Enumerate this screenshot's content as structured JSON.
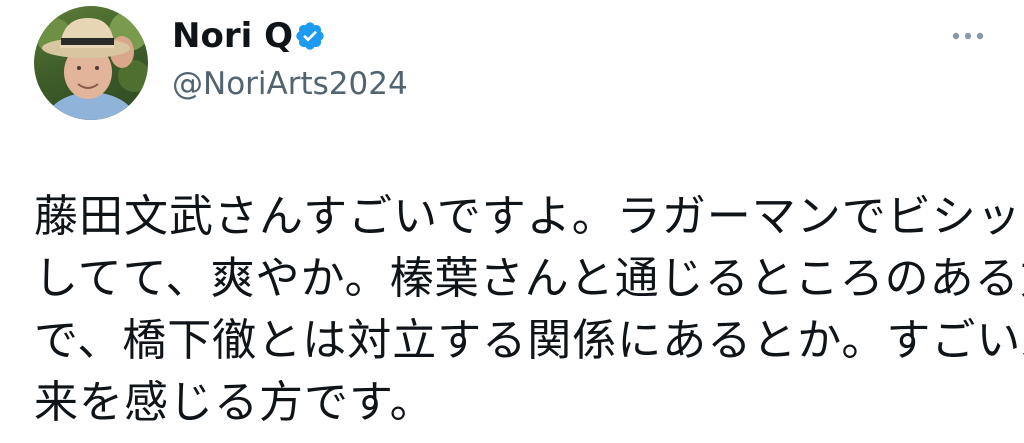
{
  "author": {
    "display_name": "Nori Q",
    "handle": "@NoriArts2024",
    "verified": true,
    "accent_color": "#1d9bf0"
  },
  "icons": {
    "verified": "verified-badge-icon",
    "more": "more-options-icon"
  },
  "tweet": {
    "lines": [
      "藤田文武さんすごいですよ。ラガーマンでビシッと",
      "してて、爽やか。榛葉さんと通じるところのある方",
      "で、橋下徹とは対立する関係にあるとか。すごい未",
      "来を感じる方です。"
    ]
  }
}
